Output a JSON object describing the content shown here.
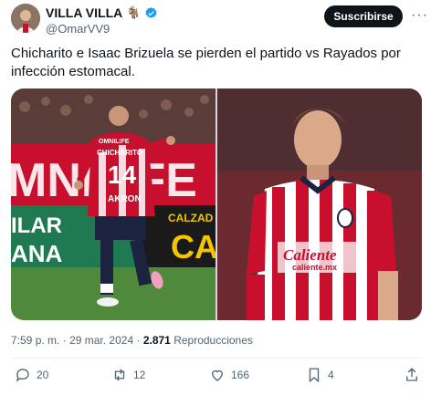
{
  "author": {
    "display_name": "VILLA VILLA",
    "emoji": "🐐",
    "handle": "@OmarVV9"
  },
  "subscribe_label": "Suscribirse",
  "tweet_text": "Chicharito e Isaac Brizuela se pierden el partido vs Rayados por infección estomacal.",
  "media": {
    "left": {
      "jersey_sponsor": "OMNILIFE",
      "jersey_name": "CHICHARITO",
      "jersey_number": "14",
      "jersey_brand": "AKRON",
      "banner_text": "MNILIFE",
      "board_text_1": "ILAR",
      "board_text_2": "ANA",
      "board_text_3": "CALZAD",
      "board_text_4": "CA"
    },
    "right": {
      "jersey_sponsor": "Caliente",
      "jersey_url": "caliente.mx"
    }
  },
  "meta": {
    "time": "7:59 p. m.",
    "separator": "·",
    "date": "29 mar. 2024",
    "views_count": "2.871",
    "views_label": "Reproducciones"
  },
  "actions": {
    "replies": "20",
    "retweets": "12",
    "likes": "166",
    "bookmarks": "4"
  },
  "colors": {
    "chivas_red": "#c8102e",
    "verified_blue": "#1d9bf0",
    "subscribe_bg": "#0f1419"
  }
}
